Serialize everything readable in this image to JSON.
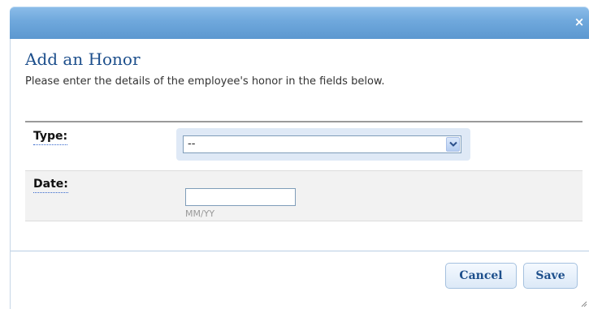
{
  "dialog": {
    "close_label": "×",
    "title": "Add an Honor",
    "subtitle": "Please enter the details of the employee's honor in the fields below."
  },
  "form": {
    "type_label": "Type:",
    "type_selected": "--",
    "date_label": "Date:",
    "date_value": "",
    "date_hint": "MM/YY"
  },
  "footer": {
    "cancel_label": "Cancel",
    "save_label": "Save"
  },
  "icons": {
    "close": "close-icon",
    "dropdown": "chevron-down-icon",
    "resize": "resize-grip-icon"
  },
  "colors": {
    "titlebar": "#6fa8dc",
    "title_text": "#1d4f8c",
    "button_text": "#1d4f8c"
  }
}
